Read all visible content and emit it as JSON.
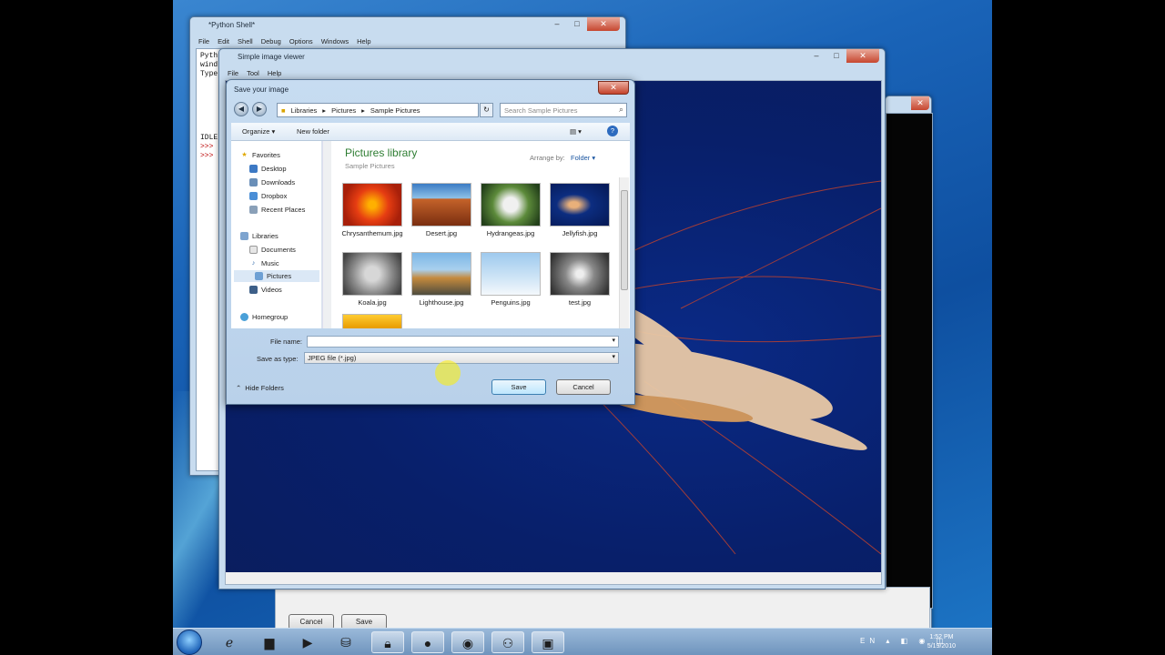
{
  "shell": {
    "title": "*Python Shell*",
    "menu": [
      "File",
      "Edit",
      "Shell",
      "Debug",
      "Options",
      "Windows",
      "Help"
    ],
    "lines": [
      "Pyth",
      "wind",
      "Type",
      "",
      "",
      "",
      "",
      "",
      "",
      "",
      "IDLE",
      "&gt;&gt;&gt;",
      "&gt;&gt;&gt;"
    ]
  },
  "viewer": {
    "title": "Simple image viewer",
    "menu": [
      "File",
      "Tool",
      "Help"
    ]
  },
  "under": {
    "cancel": "Cancel",
    "save": "Save"
  },
  "dialog": {
    "title": "Save your image",
    "breadcrumb": [
      "Libraries",
      "Pictures",
      "Sample Pictures"
    ],
    "search_placeholder": "Search Sample Pictures",
    "organize": "Organize ▾",
    "new_folder": "New folder",
    "nav": {
      "favorites": "Favorites",
      "desktop": "Desktop",
      "downloads": "Downloads",
      "dropbox": "Dropbox",
      "recent": "Recent Places",
      "libraries": "Libraries",
      "documents": "Documents",
      "music": "Music",
      "pictures": "Pictures",
      "videos": "Videos",
      "homegroup": "Homegroup"
    },
    "library_title": "Pictures library",
    "library_sub": "Sample Pictures",
    "arrange_by": "Arrange by:",
    "arrange_value": "Folder ▾",
    "files": [
      "Chrysanthemum.jpg",
      "Desert.jpg",
      "Hydrangeas.jpg",
      "Jellyfish.jpg",
      "Koala.jpg",
      "Lighthouse.jpg",
      "Penguins.jpg",
      "test.jpg"
    ],
    "file_name_label": "File name:",
    "file_name_value": "",
    "save_type_label": "Save as type:",
    "save_type_value": "JPEG file (*.jpg)",
    "hide_folders": "Hide Folders",
    "save": "Save",
    "cancel": "Cancel"
  },
  "tray": {
    "lang": "EN",
    "time": "1:52 PM",
    "date": "5/19/2010"
  }
}
